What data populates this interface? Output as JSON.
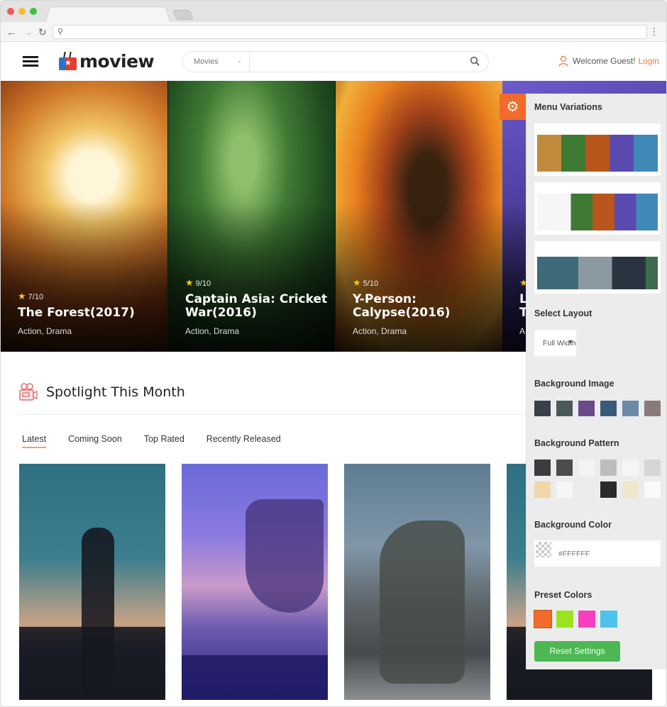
{
  "browser": {
    "url": "",
    "back_icon": "arrow-left-icon",
    "forward_icon": "arrow-right-icon",
    "reload_icon": "reload-icon",
    "menu_icon": "kebab-menu-icon"
  },
  "header": {
    "logo_text": "moview",
    "search": {
      "category": "Movies",
      "placeholder": ""
    },
    "welcome_text": "Welcome Guest!",
    "login_label": "Login"
  },
  "hero": {
    "slides": [
      {
        "rating": "7/10",
        "title": "The Forest(2017)",
        "genre": "Action, Drama"
      },
      {
        "rating": "9/10",
        "title": "Captain Asia: Cricket War(2016)",
        "genre": "Action, Drama"
      },
      {
        "rating": "5/10",
        "title": "Y-Person: Calypse(2016)",
        "genre": "Action, Drama"
      },
      {
        "rating": "",
        "title": "L T",
        "genre": "A"
      }
    ]
  },
  "spotlight": {
    "title": "Spotlight This Month",
    "tabs": [
      {
        "label": "Latest",
        "active": true
      },
      {
        "label": "Coming Soon",
        "active": false
      },
      {
        "label": "Top Rated",
        "active": false
      },
      {
        "label": "Recently Released",
        "active": false
      }
    ]
  },
  "settings_panel": {
    "menu_variations_title": "Menu Variations",
    "select_layout_title": "Select Layout",
    "layout_value": "Full Width",
    "background_image_title": "Background Image",
    "background_pattern_title": "Background Pattern",
    "background_color_title": "Background Color",
    "background_color_value": "#FFFFFF",
    "preset_colors_title": "Preset Colors",
    "preset_colors": [
      "#f26b2a",
      "#9be31f",
      "#f43fc0",
      "#4ec2ec"
    ],
    "reset_label": "Reset Settings",
    "accent_color": "#f26b2a",
    "reset_color": "#4db853"
  }
}
